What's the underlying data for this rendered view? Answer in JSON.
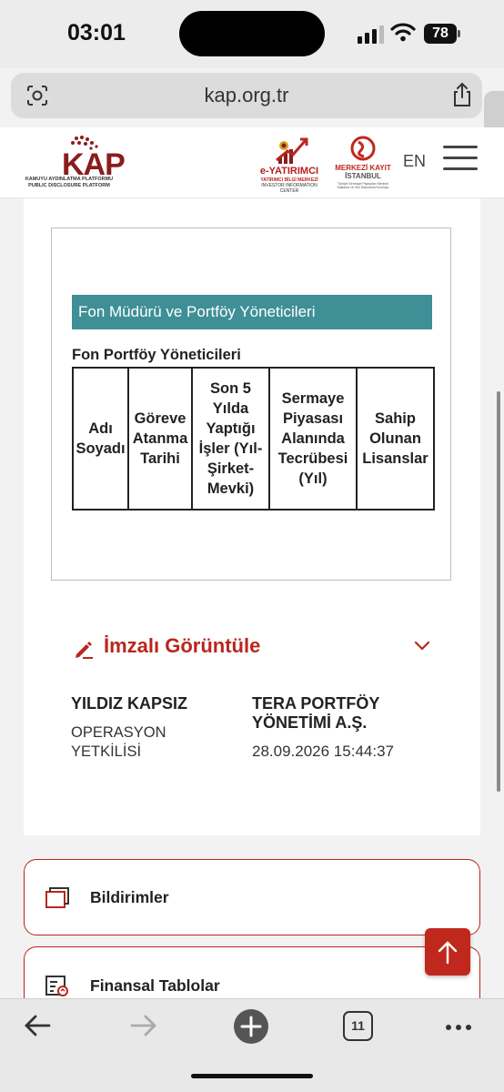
{
  "status_bar": {
    "time": "03:01",
    "battery": "78",
    "icons": [
      "signal-icon",
      "wifi-icon",
      "battery-icon"
    ]
  },
  "browser": {
    "url": "kap.org.tr",
    "icons": [
      "reader-mode-icon",
      "share-icon",
      "back-swipe-icon"
    ]
  },
  "header": {
    "logo_letters": "KAP",
    "logo_line1": "KAMUYU AYDINLATMA PLATFORMU",
    "logo_line2": "PUBLIC DISCLOSURE PLATFORM",
    "eyat_title": "e-YATIRIMCI",
    "eyat_sub1": "YATIRIMCI BİLGİ MERKEZİ",
    "eyat_sub2": "INVESTOR INFORMATION CENTER",
    "mkk_title1": "MERKEZİ KAYIT",
    "mkk_title2": "İSTANBUL",
    "mkk_sub": "Türkiye Sermaye Piyasaları Merkezi Saklama ve Veri Depolama Kuruluşu",
    "lang": "EN",
    "menu_icon": "hamburger-icon"
  },
  "section": {
    "teal_title": "Fon Müdürü ve Portföy Yöneticileri",
    "subtitle": "Fon Portföy Yöneticileri",
    "table_headers": [
      [
        "Adı",
        "Soyadı"
      ],
      [
        "Göreve",
        "Atanma",
        "Tarihi"
      ],
      [
        "Son 5",
        "Yılda",
        "Yaptığı",
        "İşler (Yıl-",
        "Şirket-",
        "Mevki)"
      ],
      [
        "Sermaye",
        "Piyasası",
        "Alanında",
        "Tecrübesi",
        "(Yıl)"
      ],
      [
        "Sahip",
        "Olunan",
        "Lisanslar"
      ]
    ]
  },
  "signature": {
    "label": "İmzalı Görüntüle",
    "name": "YILDIZ KAPSIZ",
    "role_line1": "OPERASYON",
    "role_line2": "YETKİLİSİ",
    "company_line1": "TERA PORTFÖY",
    "company_line2": "YÖNETİMİ A.Ş.",
    "date": "28.09.2026 15:44:37"
  },
  "nav_items": [
    {
      "label": "Bildirimler",
      "icon": "notifications-icon"
    },
    {
      "label": "Finansal Tablolar",
      "icon": "financial-tables-icon"
    }
  ],
  "toolbar": {
    "tabs_count": "11",
    "icons": [
      "back-arrow-icon",
      "forward-arrow-icon",
      "new-tab-plus-icon",
      "tabs-icon",
      "more-icon"
    ]
  },
  "colors": {
    "brand_red": "#b8271e",
    "teal": "#3f8f96"
  }
}
